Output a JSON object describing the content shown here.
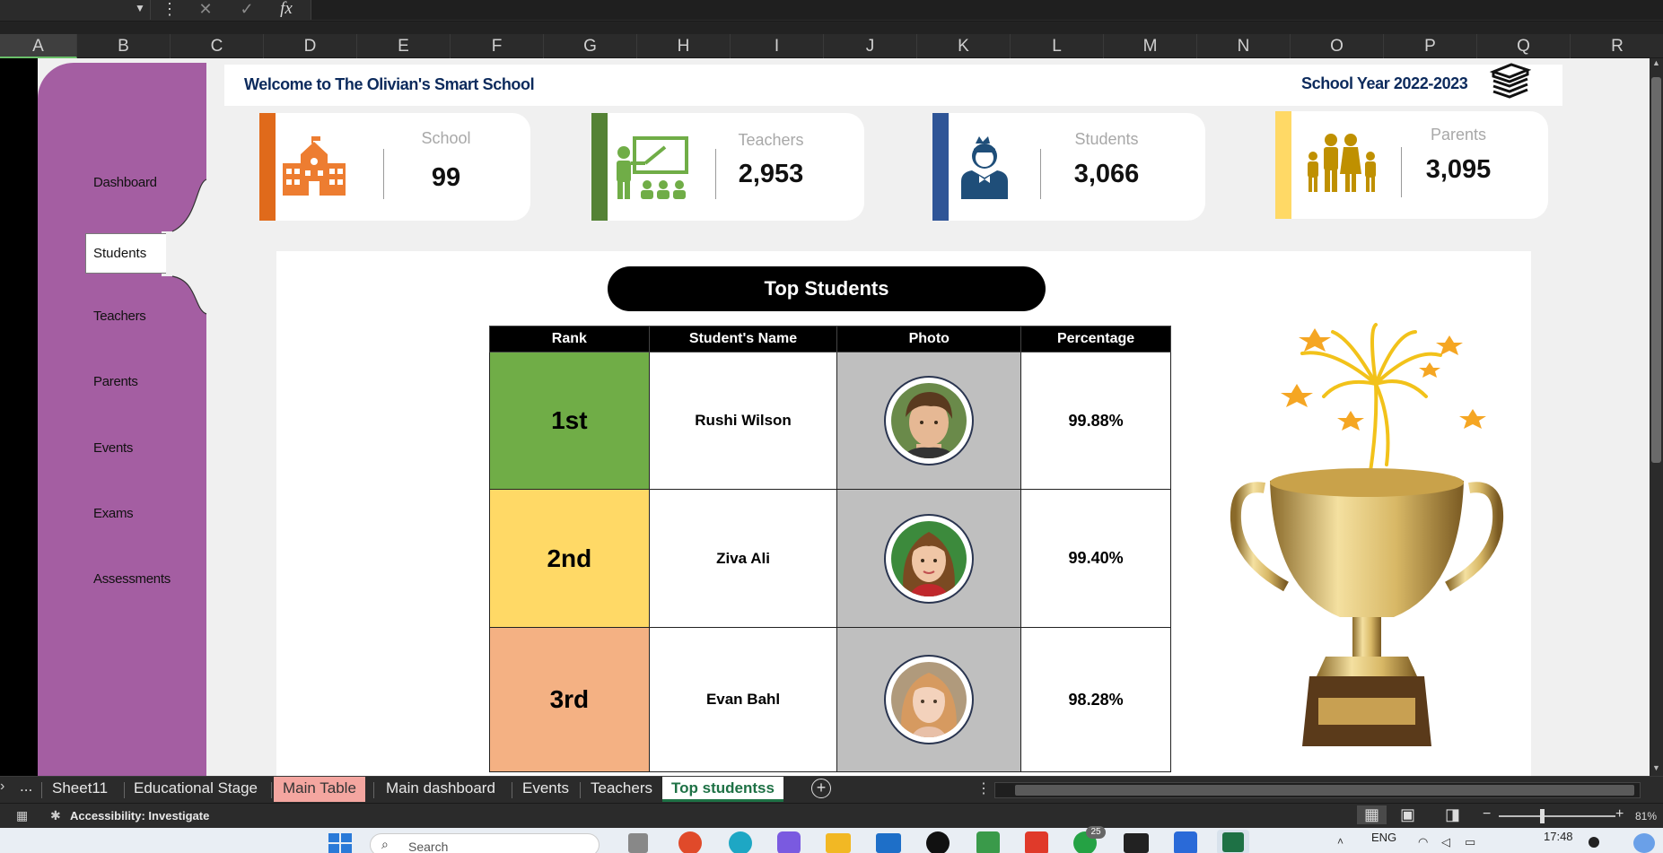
{
  "formula_bar": {
    "fx_label": "fx"
  },
  "columns": [
    "A",
    "B",
    "C",
    "D",
    "E",
    "F",
    "G",
    "H",
    "I",
    "J",
    "K",
    "L",
    "M",
    "N",
    "O",
    "P",
    "Q",
    "R"
  ],
  "sidebar": {
    "items": [
      {
        "label": "Dashboard"
      },
      {
        "label": "Students"
      },
      {
        "label": "Teachers"
      },
      {
        "label": "Parents"
      },
      {
        "label": "Events"
      },
      {
        "label": "Exams"
      },
      {
        "label": "Assessments"
      }
    ]
  },
  "header": {
    "welcome": "Welcome to The Olivian's Smart School",
    "school_year": "School Year 2022-2023"
  },
  "kpis": [
    {
      "label": "School",
      "value": "99",
      "color": "#e06a1b",
      "icon": "school-building-icon"
    },
    {
      "label": "Teachers",
      "value": "2,953",
      "color": "#548235",
      "icon": "teacher-board-icon"
    },
    {
      "label": "Students",
      "value": "3,066",
      "color": "#2f5597",
      "icon": "student-icon"
    },
    {
      "label": "Parents",
      "value": "3,095",
      "color": "#ffd966",
      "icon": "family-icon"
    }
  ],
  "top_students": {
    "title": "Top Students",
    "headers": [
      "Rank",
      "Student's Name",
      "Photo",
      "Percentage"
    ],
    "rows": [
      {
        "rank": "1st",
        "name": "Rushi Wilson",
        "percentage": "99.88%",
        "color": "#70ad47"
      },
      {
        "rank": "2nd",
        "name": "Ziva Ali",
        "percentage": "99.40%",
        "color": "#ffd966"
      },
      {
        "rank": "3rd",
        "name": "Evan Bahl",
        "percentage": "98.28%",
        "color": "#f4b183"
      }
    ]
  },
  "sheet_tabs": {
    "more": "...",
    "tabs": [
      {
        "label": "Sheet11"
      },
      {
        "label": "Educational Stage"
      },
      {
        "label": "Main Table"
      },
      {
        "label": "Main dashboard"
      },
      {
        "label": "Events"
      },
      {
        "label": "Teachers"
      },
      {
        "label": "Top studentss"
      }
    ]
  },
  "status": {
    "accessibility": "Accessibility: Investigate",
    "zoom": "81%"
  },
  "taskbar": {
    "search_placeholder": "Search",
    "language": "ENG",
    "time": "17:48",
    "badge": "25"
  }
}
